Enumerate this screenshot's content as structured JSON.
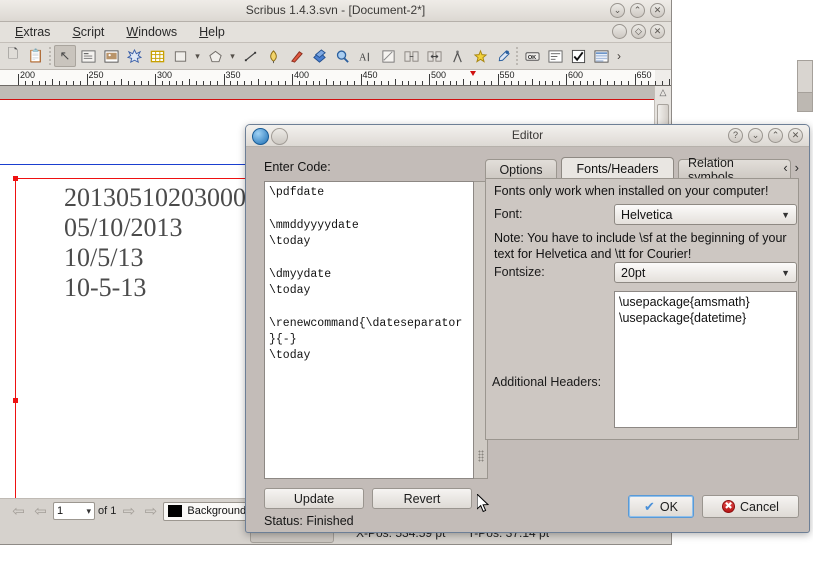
{
  "main_window": {
    "title": "Scribus 1.4.3.svn - [Document-2*]",
    "menu": [
      {
        "label": "Extras",
        "mnemonic": "x"
      },
      {
        "label": "Script",
        "mnemonic": "S"
      },
      {
        "label": "Windows",
        "mnemonic": "W"
      },
      {
        "label": "Help",
        "mnemonic": "H"
      }
    ],
    "window_buttons": [
      {
        "name": "minimize-button",
        "glyph": "⌄"
      },
      {
        "name": "maximize-button",
        "glyph": "⌃"
      },
      {
        "name": "close-button",
        "glyph": "✕"
      }
    ],
    "mdi_buttons": [
      {
        "name": "mdi-minimize-button",
        "glyph": ""
      },
      {
        "name": "mdi-restore-button",
        "glyph": "◇"
      },
      {
        "name": "mdi-close-button",
        "glyph": "✕"
      }
    ],
    "toolbar_icons": [
      "new-document-icon",
      "copy-icon",
      "separator",
      "select-item-icon",
      "text-frame-icon",
      "image-frame-icon",
      "render-frame-icon",
      "table-icon",
      "shape-icon",
      "shape-dropdown",
      "polygon-icon",
      "polygon-dropdown",
      "line-icon",
      "bezier-icon",
      "freehand-line-icon",
      "rotate-item-icon",
      "zoom-icon",
      "edit-contents-icon",
      "edit-text-icon",
      "link-text-frames-icon",
      "unlink-text-frames-icon",
      "measurements-icon",
      "copy-item-properties-icon",
      "eyedropper-icon",
      "separator",
      "pdf-push-button-icon",
      "pdf-text-field-icon",
      "pdf-checkbox-icon",
      "pdf-combo-box-icon",
      "toolbar-overflow-icon"
    ],
    "ruler": {
      "unit": "pt",
      "labels": [
        "200",
        "250",
        "300",
        "350",
        "400",
        "450",
        "500",
        "550",
        "600",
        "650"
      ],
      "marker_value": "530"
    },
    "canvas_text": "20130510203000\n05/10/2013\n10/5/13\n10-5-13",
    "statusbar": {
      "page_value": "1",
      "page_total": "of 1",
      "layer": "Background",
      "xpos_label": "X-Pos:",
      "xpos_value": "534.59 pt",
      "ypos_label": "Y-Pos:",
      "ypos_value": "37.14 pt",
      "nav_first": "first-page-icon",
      "nav_prev": "previous-page-icon",
      "nav_next": "next-page-icon",
      "nav_last": "last-page-icon"
    }
  },
  "dialog": {
    "title": "Editor",
    "titlebar_buttons": [
      {
        "name": "help-button",
        "glyph": "?"
      },
      {
        "name": "minimize-button",
        "glyph": "⌄"
      },
      {
        "name": "maximize-button",
        "glyph": "⌃"
      },
      {
        "name": "close-button",
        "glyph": "✕"
      }
    ],
    "enter_code_label": "Enter Code:",
    "code": "\\pdfdate\n\n\\mmddyyyydate\n\\today\n\n\\dmyydate\n\\today\n\n\\renewcommand{\\dateseparator\n}{-}\n\\today",
    "update_label": "Update",
    "revert_label": "Revert",
    "status_label": "Status: Finished",
    "tabs": [
      {
        "label": "Options",
        "active": false
      },
      {
        "label": "Fonts/Headers",
        "active": true
      },
      {
        "label": "Relation symbols",
        "active": false
      }
    ],
    "tab_nav_prev": "‹",
    "tab_nav_next": "›",
    "fonts_panel": {
      "notice": "Fonts only work when installed on your computer!",
      "font_label": "Font:",
      "font_value": "Helvetica",
      "note": "Note: You have to include \\sf at the beginning of your text for Helvetica and \\tt for Courier!",
      "fontsize_label": "Fontsize:",
      "fontsize_value": "20pt",
      "headers_label": "Additional Headers:",
      "headers_value": "\\usepackage{amsmath}\n\\usepackage{datetime}"
    },
    "ok_label": "OK",
    "cancel_label": "Cancel"
  },
  "colors": {
    "dialog_bg": "#c3bcb8",
    "window_bg": "#d6d2cd",
    "frame_red": "#ee1111",
    "margin_blue": "#1a3fd0",
    "accent_blue": "#4a90d9"
  }
}
